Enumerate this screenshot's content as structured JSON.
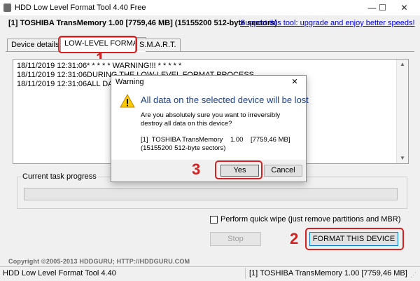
{
  "window": {
    "title": "HDD Low Level Format Tool 4.40   Free",
    "controls": {
      "minimize": "—",
      "maximize": "☐",
      "close": "✕"
    }
  },
  "device_line": {
    "text": "[1]  TOSHIBA TransMemory    1.00    [7759,46 MB]    (15155200 512-byte sectors)",
    "promo_link": "Support this tool: upgrade and enjoy better speeds!"
  },
  "tabs": [
    {
      "label": "Device details"
    },
    {
      "label": "LOW-LEVEL FORMAT"
    },
    {
      "label": "S.M.A.R.T."
    }
  ],
  "log": [
    {
      "time": "18/11/2019 12:31:06",
      "message": "* * * * *  WARNING!!! * * * * *"
    },
    {
      "time": "18/11/2019 12:31:06",
      "message": "DURING THE LOW-LEVEL FORMAT PROCESS"
    },
    {
      "time": "18/11/2019 12:31:06",
      "message": "ALL DATA"
    }
  ],
  "progress": {
    "label": "Current task progress",
    "value": 0
  },
  "quick_wipe": {
    "label": "Perform quick wipe (just remove partitions and MBR)",
    "checked": false
  },
  "buttons": {
    "stop": "Stop",
    "format": "FORMAT THIS DEVICE"
  },
  "copyright": "Copyright ©2005-2013 HDDGURU;   HTTP://HDDGURU.COM",
  "status_bar": {
    "left": "HDD Low Level Format Tool 4.40",
    "right": "[1]  TOSHIBA TransMemory    1.00    [7759,46 MB]"
  },
  "dialog": {
    "title": "Warning",
    "close_glyph": "✕",
    "heading": "All data on the selected device will be lost",
    "body": "Are you absolutely sure you want to irreversibly destroy all data on this device?",
    "device_info": "[1]  TOSHIBA TransMemory    1.00    [7759,46 MB]\n(15155200 512-byte sectors)",
    "yes": "Yes",
    "cancel": "Cancel"
  },
  "annotations": {
    "step1": "1",
    "step2": "2",
    "step3": "3"
  },
  "colors": {
    "annotation_red": "#d42020",
    "link_blue": "#0000ee",
    "heading_blue": "#1e3f8a",
    "focus_blue": "#0078d7"
  }
}
